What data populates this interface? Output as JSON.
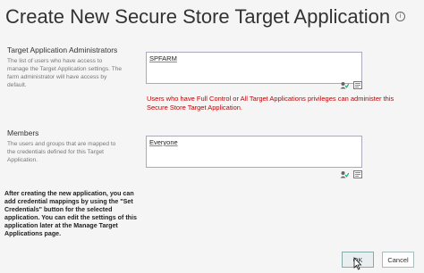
{
  "page": {
    "title": "Create New Secure Store Target Application",
    "info_glyph": "i"
  },
  "admins": {
    "heading": "Target Application Administrators",
    "description": "The list of users who have access to manage the Target Application settings. The farm administrator will have access by default.",
    "value": "SPFARM",
    "error": "Users who have Full Control or All Target Applications privileges can administer this Secure Store Target Application."
  },
  "members": {
    "heading": "Members",
    "description": "The users and groups that are mapped to the credentials defined for this Target Application.",
    "value": "Everyone"
  },
  "note": "After creating the new application, you can add credential mappings by using the \"Set Credentials\" button for the selected application. You can edit the settings of this application later at the Manage Target Applications page.",
  "buttons": {
    "ok_label": "OK",
    "cancel_label": "Cancel"
  },
  "icons": [
    "info-icon",
    "check-names-icon",
    "browse-icon",
    "mouse-cursor-icon"
  ]
}
